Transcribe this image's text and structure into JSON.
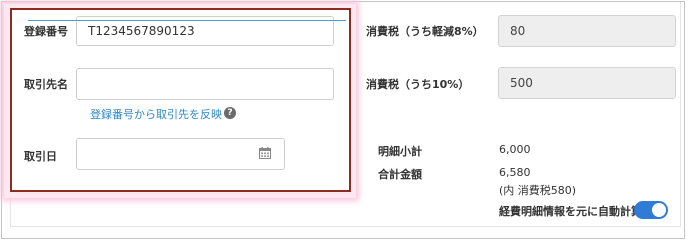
{
  "form": {
    "registration_label": "登録番号",
    "registration_value": "T1234567890123",
    "partner_label": "取引先名",
    "partner_value": "",
    "reflect_link": "登録番号から取引先を反映",
    "help_glyph": "?",
    "date_label": "取引日",
    "date_value": "",
    "date_icon": "calendar-icon"
  },
  "tax": {
    "reduced_label": "消費税（うち軽減8%）",
    "reduced_value": "80",
    "standard_label": "消費税（うち10%）",
    "standard_value": "500"
  },
  "totals": {
    "subtotal_label": "明細小計",
    "subtotal_value": "6,000",
    "total_label": "合計金額",
    "total_value": "6,580",
    "total_tax_note": "(内 消費税580)",
    "auto_calc_label": "経費明細情報を元に自動計算",
    "auto_calc_on": true
  },
  "colors": {
    "highlight_border": "#8b2e21",
    "link": "#2f89c5",
    "toggle_on": "#2f7bd6"
  }
}
